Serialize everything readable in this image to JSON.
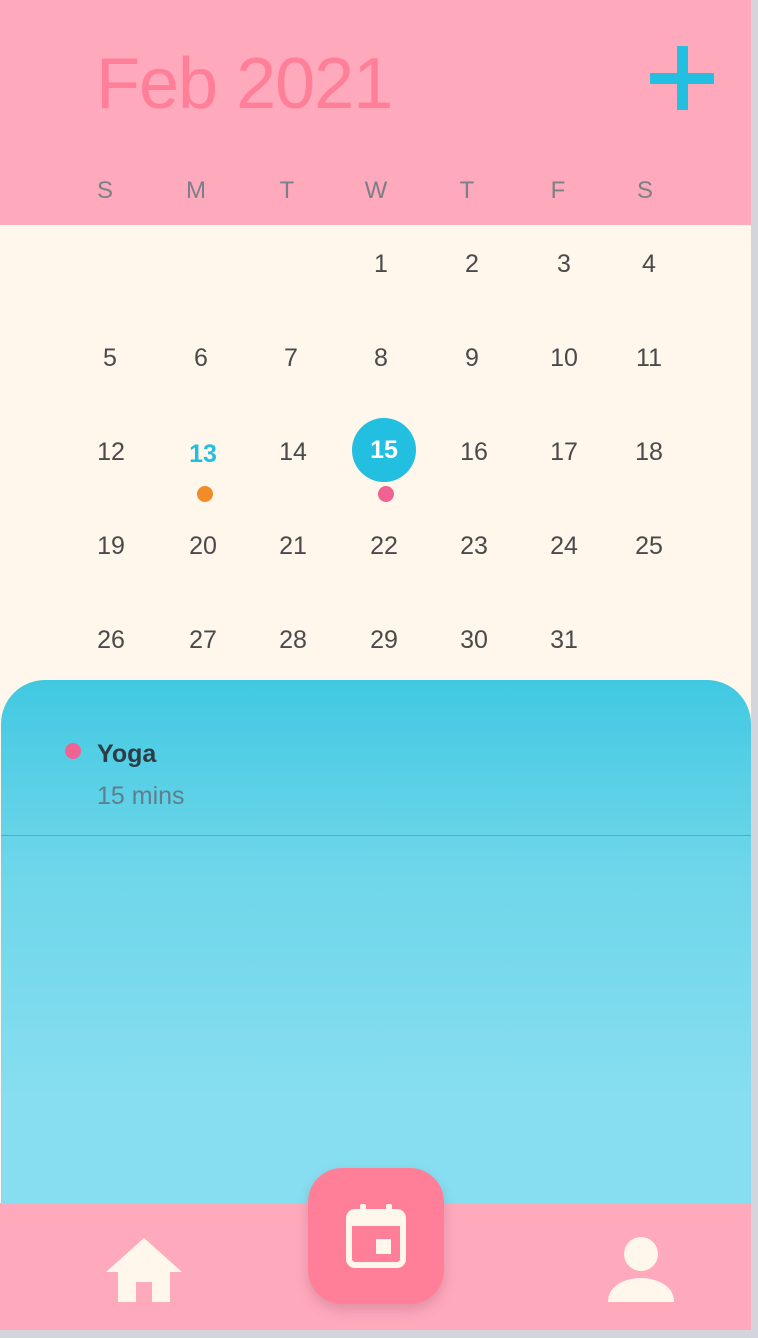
{
  "header": {
    "month_title": "Feb 2021",
    "add_icon": "plus-icon"
  },
  "weekdays": [
    "S",
    "M",
    "T",
    "W",
    "T",
    "F",
    "S"
  ],
  "calendar": {
    "weeks": [
      [
        "",
        "",
        "",
        "1",
        "2",
        "3",
        "4"
      ],
      [
        "5",
        "6",
        "7",
        "8",
        "9",
        "10",
        "11"
      ],
      [
        "12",
        "13",
        "14",
        "15",
        "16",
        "17",
        "18"
      ],
      [
        "19",
        "20",
        "21",
        "22",
        "23",
        "24",
        "25"
      ],
      [
        "26",
        "27",
        "28",
        "29",
        "30",
        "31",
        ""
      ]
    ],
    "today": "13",
    "selected": "15",
    "event_markers": [
      {
        "day": "13",
        "color": "#f28c28"
      },
      {
        "day": "15",
        "color": "#f06292"
      }
    ]
  },
  "events": [
    {
      "title": "Yoga",
      "duration": "15 mins",
      "dot_color": "#f06292"
    }
  ],
  "bottom_nav": {
    "home_icon": "home-icon",
    "calendar_icon": "calendar-icon",
    "profile_icon": "person-icon"
  },
  "colors": {
    "header_bg": "#ffa9bd",
    "title": "#ff7f98",
    "accent": "#22bfe0",
    "calendar_bg": "#fff6ec",
    "fab_bg": "#ff7f98"
  }
}
